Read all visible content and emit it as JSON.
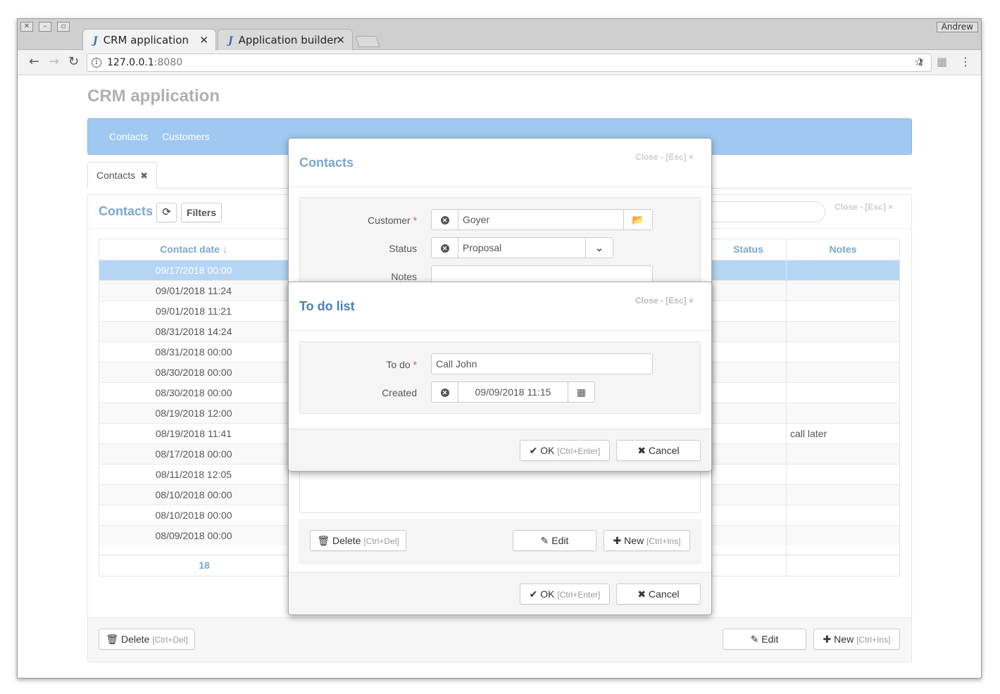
{
  "browser": {
    "tabs": [
      {
        "label": "CRM application"
      },
      {
        "label": "Application builder"
      }
    ],
    "user": "Andrew",
    "url_host": "127.0.0.1",
    "url_port": ":8080"
  },
  "app": {
    "title": "CRM application",
    "nav": [
      "Contacts",
      "Customers"
    ],
    "page_tab": "Contacts"
  },
  "contacts_panel": {
    "title": "Contacts",
    "filters_label": "Filters",
    "close_hint": "Close - [Esc] ×",
    "columns": [
      "Contact date",
      "Status",
      "Notes"
    ],
    "rows": [
      {
        "date": "09/17/2018 00:00",
        "note": ""
      },
      {
        "date": "09/01/2018 11:24",
        "note": ""
      },
      {
        "date": "09/01/2018 11:21",
        "note": ""
      },
      {
        "date": "08/31/2018 14:24",
        "note": ""
      },
      {
        "date": "08/31/2018 00:00",
        "note": ""
      },
      {
        "date": "08/30/2018 00:00",
        "note": ""
      },
      {
        "date": "08/30/2018 00:00",
        "note": ""
      },
      {
        "date": "08/19/2018 12:00",
        "note": ""
      },
      {
        "date": "08/19/2018 11:41",
        "note": "call later"
      },
      {
        "date": "08/17/2018 00:00",
        "note": ""
      },
      {
        "date": "08/11/2018 12:05",
        "note": ""
      },
      {
        "date": "08/10/2018 00:00",
        "note": ""
      },
      {
        "date": "08/10/2018 00:00",
        "note": ""
      },
      {
        "date": "08/09/2018 00:00",
        "note": ""
      }
    ],
    "total": "18",
    "delete_label": "Delete",
    "delete_hint": "[Ctrl+Del]",
    "edit_label": "Edit",
    "new_label": "New",
    "new_hint": "[Ctrl+Ins]"
  },
  "contact_dialog": {
    "title": "Contacts",
    "close_hint": "Close - [Esc] ×",
    "customer_label": "Customer",
    "customer_value": "Goyer",
    "status_label": "Status",
    "status_value": "Proposal",
    "notes_label": "Notes",
    "delete_label": "Delete",
    "delete_hint": "[Ctrl+Del]",
    "edit_label": "Edit",
    "new_label": "New",
    "new_hint": "[Ctrl+Ins]",
    "ok_label": "OK",
    "ok_hint": "[Ctrl+Enter]",
    "cancel_label": "Cancel"
  },
  "todo_dialog": {
    "title": "To do list",
    "close_hint": "Close - [Esc] ×",
    "todo_label": "To do",
    "todo_value": "Call John",
    "created_label": "Created",
    "created_value": "09/09/2018 11:15",
    "ok_label": "OK",
    "ok_hint": "[Ctrl+Enter]",
    "cancel_label": "Cancel"
  },
  "colors": {
    "accent": "#7aa7d2",
    "navbar": "#9fc9f0",
    "selected_row": "#b5d5f5",
    "dialog_title": "#4a7fb5",
    "required": "#d9534f"
  }
}
